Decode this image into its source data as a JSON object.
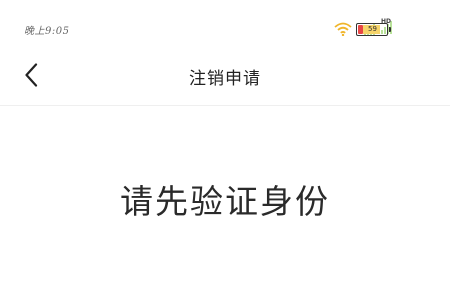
{
  "status_bar": {
    "time": "晚上9:05",
    "network_label": "HD",
    "battery_level": "59",
    "icons": [
      "signal-icon",
      "hd-signal-icon",
      "wifi-icon",
      "battery-icon"
    ],
    "colors": {
      "signal": "#b9e29a",
      "wifi": "#f0b52a",
      "battery_low": "#e84646",
      "battery_fill": "#f6d46a"
    }
  },
  "nav": {
    "back_icon": "chevron-left-icon",
    "title": "注销申请"
  },
  "main": {
    "heading": "请先验证身份"
  }
}
